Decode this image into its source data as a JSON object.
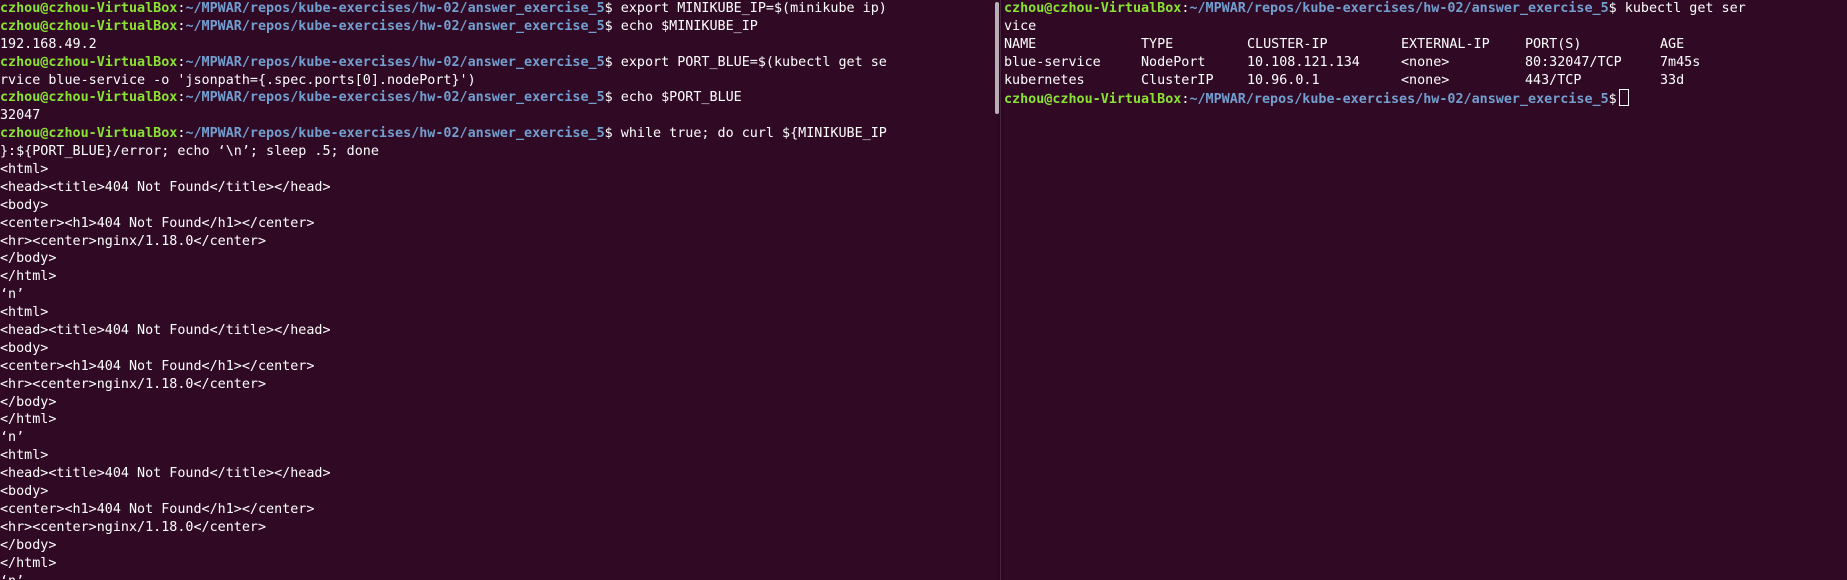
{
  "prompt": {
    "user_host": "czhou@czhou-VirtualBox",
    "sep": ":",
    "path": "~/MPWAR/repos/kube-exercises/hw-02/answer_exercise_5",
    "symbol": "$"
  },
  "left_terminal": {
    "commands": {
      "c1": " export MINIKUBE_IP=$(minikube ip)",
      "c2": " echo $MINIKUBE_IP",
      "c3": " export PORT_BLUE=$(kubectl get se",
      "c4": " echo $PORT_BLUE",
      "c5": " while true; do curl ${MINIKUBE_IP"
    },
    "lines": {
      "l2": "192.168.49.2",
      "l4": "rvice blue-service -o 'jsonpath={.spec.ports[0].nodePort}')",
      "l6": "32047",
      "l8": "}:${PORT_BLUE}/error; echo ‘\\n’; sleep .5; done"
    },
    "output": [
      "<html>",
      "<head><title>404 Not Found</title></head>",
      "<body>",
      "<center><h1>404 Not Found</h1></center>",
      "<hr><center>nginx/1.18.0</center>",
      "</body>",
      "</html>",
      "‘n’",
      "<html>",
      "<head><title>404 Not Found</title></head>",
      "<body>",
      "<center><h1>404 Not Found</h1></center>",
      "<hr><center>nginx/1.18.0</center>",
      "</body>",
      "</html>",
      "‘n’",
      "<html>",
      "<head><title>404 Not Found</title></head>",
      "<body>",
      "<center><h1>404 Not Found</h1></center>",
      "<hr><center>nginx/1.18.0</center>",
      "</body>",
      "</html>",
      "‘n’"
    ]
  },
  "right_terminal": {
    "command": " kubectl get ser",
    "command_wrap": "vice",
    "table": {
      "headers": {
        "name": "NAME",
        "type": "TYPE",
        "cluster_ip": "CLUSTER-IP",
        "external_ip": "EXTERNAL-IP",
        "ports": "PORT(S)",
        "age": "AGE"
      },
      "rows": [
        {
          "name": "blue-service",
          "type": "NodePort",
          "cluster_ip": "10.108.121.134",
          "external_ip": "<none>",
          "ports": "80:32047/TCP",
          "age": "7m45s"
        },
        {
          "name": "kubernetes",
          "type": "ClusterIP",
          "cluster_ip": "10.96.0.1",
          "external_ip": "<none>",
          "ports": "443/TCP",
          "age": "33d"
        }
      ]
    }
  },
  "colors": {
    "background": "#300a24",
    "prompt_user": "#8ae234",
    "prompt_path": "#729fcf",
    "text": "#ffffff"
  }
}
